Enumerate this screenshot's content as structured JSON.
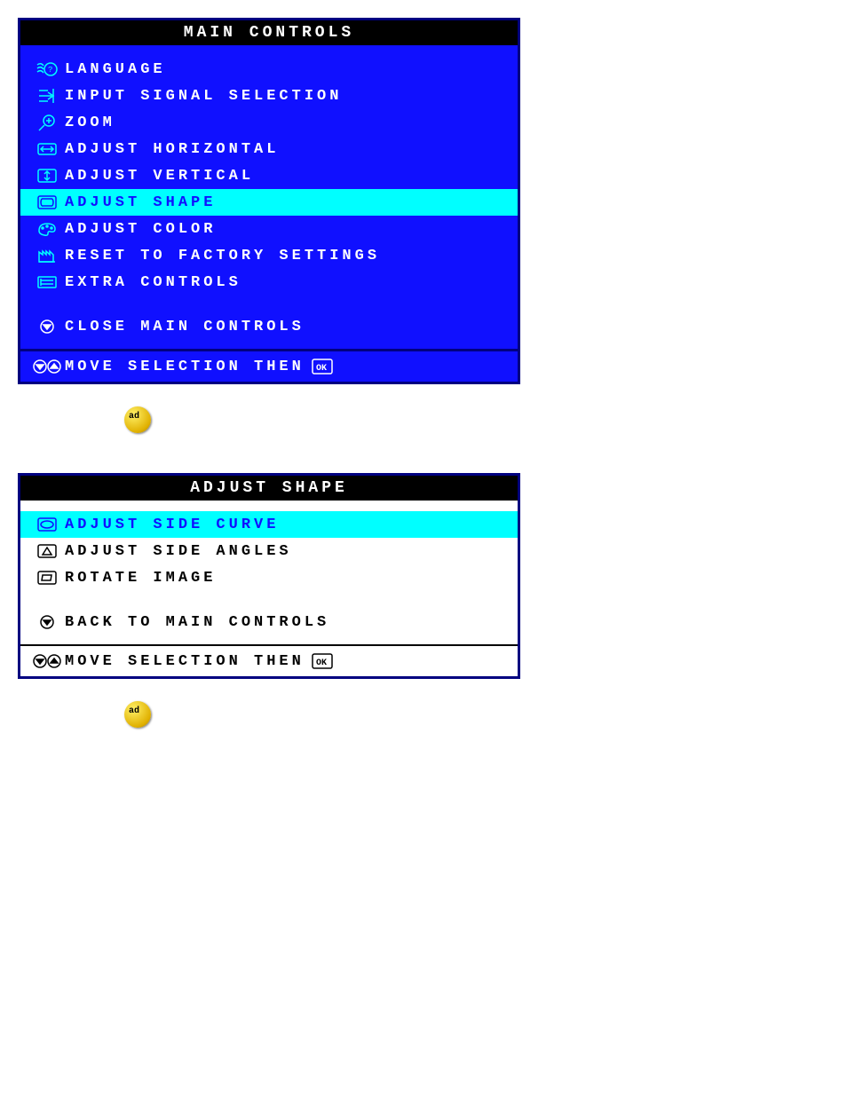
{
  "main": {
    "title": "MAIN CONTROLS",
    "items": [
      {
        "label": "LANGUAGE"
      },
      {
        "label": "INPUT SIGNAL SELECTION"
      },
      {
        "label": "ZOOM"
      },
      {
        "label": "ADJUST HORIZONTAL"
      },
      {
        "label": "ADJUST VERTICAL"
      },
      {
        "label": "ADJUST SHAPE"
      },
      {
        "label": "ADJUST COLOR"
      },
      {
        "label": "RESET TO FACTORY SETTINGS"
      },
      {
        "label": "EXTRA CONTROLS"
      }
    ],
    "close": "CLOSE MAIN CONTROLS",
    "footer": "MOVE SELECTION THEN"
  },
  "shape": {
    "title": "ADJUST SHAPE",
    "items": [
      {
        "label": "ADJUST SIDE CURVE"
      },
      {
        "label": "ADJUST SIDE ANGLES"
      },
      {
        "label": "ROTATE IMAGE"
      }
    ],
    "back": "BACK TO MAIN CONTROLS",
    "footer": "MOVE SELECTION THEN"
  }
}
